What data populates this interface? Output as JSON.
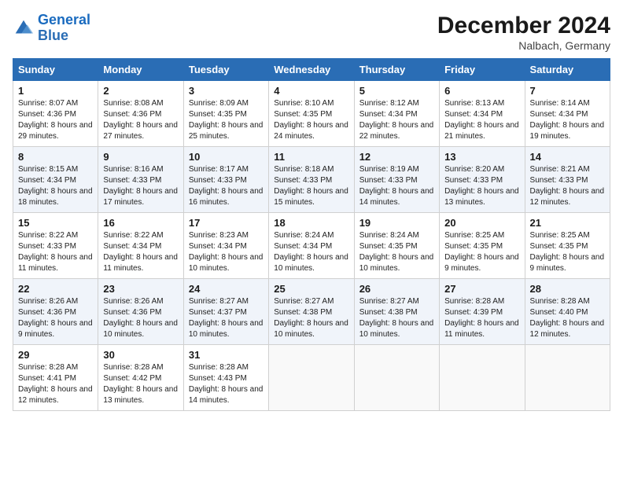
{
  "header": {
    "logo_line1": "General",
    "logo_line2": "Blue",
    "month": "December 2024",
    "location": "Nalbach, Germany"
  },
  "weekdays": [
    "Sunday",
    "Monday",
    "Tuesday",
    "Wednesday",
    "Thursday",
    "Friday",
    "Saturday"
  ],
  "weeks": [
    [
      {
        "day": 1,
        "sunrise": "8:07 AM",
        "sunset": "4:36 PM",
        "daylight": "8 hours and 29 minutes."
      },
      {
        "day": 2,
        "sunrise": "8:08 AM",
        "sunset": "4:36 PM",
        "daylight": "8 hours and 27 minutes."
      },
      {
        "day": 3,
        "sunrise": "8:09 AM",
        "sunset": "4:35 PM",
        "daylight": "8 hours and 25 minutes."
      },
      {
        "day": 4,
        "sunrise": "8:10 AM",
        "sunset": "4:35 PM",
        "daylight": "8 hours and 24 minutes."
      },
      {
        "day": 5,
        "sunrise": "8:12 AM",
        "sunset": "4:34 PM",
        "daylight": "8 hours and 22 minutes."
      },
      {
        "day": 6,
        "sunrise": "8:13 AM",
        "sunset": "4:34 PM",
        "daylight": "8 hours and 21 minutes."
      },
      {
        "day": 7,
        "sunrise": "8:14 AM",
        "sunset": "4:34 PM",
        "daylight": "8 hours and 19 minutes."
      }
    ],
    [
      {
        "day": 8,
        "sunrise": "8:15 AM",
        "sunset": "4:34 PM",
        "daylight": "8 hours and 18 minutes."
      },
      {
        "day": 9,
        "sunrise": "8:16 AM",
        "sunset": "4:33 PM",
        "daylight": "8 hours and 17 minutes."
      },
      {
        "day": 10,
        "sunrise": "8:17 AM",
        "sunset": "4:33 PM",
        "daylight": "8 hours and 16 minutes."
      },
      {
        "day": 11,
        "sunrise": "8:18 AM",
        "sunset": "4:33 PM",
        "daylight": "8 hours and 15 minutes."
      },
      {
        "day": 12,
        "sunrise": "8:19 AM",
        "sunset": "4:33 PM",
        "daylight": "8 hours and 14 minutes."
      },
      {
        "day": 13,
        "sunrise": "8:20 AM",
        "sunset": "4:33 PM",
        "daylight": "8 hours and 13 minutes."
      },
      {
        "day": 14,
        "sunrise": "8:21 AM",
        "sunset": "4:33 PM",
        "daylight": "8 hours and 12 minutes."
      }
    ],
    [
      {
        "day": 15,
        "sunrise": "8:22 AM",
        "sunset": "4:33 PM",
        "daylight": "8 hours and 11 minutes."
      },
      {
        "day": 16,
        "sunrise": "8:22 AM",
        "sunset": "4:34 PM",
        "daylight": "8 hours and 11 minutes."
      },
      {
        "day": 17,
        "sunrise": "8:23 AM",
        "sunset": "4:34 PM",
        "daylight": "8 hours and 10 minutes."
      },
      {
        "day": 18,
        "sunrise": "8:24 AM",
        "sunset": "4:34 PM",
        "daylight": "8 hours and 10 minutes."
      },
      {
        "day": 19,
        "sunrise": "8:24 AM",
        "sunset": "4:35 PM",
        "daylight": "8 hours and 10 minutes."
      },
      {
        "day": 20,
        "sunrise": "8:25 AM",
        "sunset": "4:35 PM",
        "daylight": "8 hours and 9 minutes."
      },
      {
        "day": 21,
        "sunrise": "8:25 AM",
        "sunset": "4:35 PM",
        "daylight": "8 hours and 9 minutes."
      }
    ],
    [
      {
        "day": 22,
        "sunrise": "8:26 AM",
        "sunset": "4:36 PM",
        "daylight": "8 hours and 9 minutes."
      },
      {
        "day": 23,
        "sunrise": "8:26 AM",
        "sunset": "4:36 PM",
        "daylight": "8 hours and 10 minutes."
      },
      {
        "day": 24,
        "sunrise": "8:27 AM",
        "sunset": "4:37 PM",
        "daylight": "8 hours and 10 minutes."
      },
      {
        "day": 25,
        "sunrise": "8:27 AM",
        "sunset": "4:38 PM",
        "daylight": "8 hours and 10 minutes."
      },
      {
        "day": 26,
        "sunrise": "8:27 AM",
        "sunset": "4:38 PM",
        "daylight": "8 hours and 10 minutes."
      },
      {
        "day": 27,
        "sunrise": "8:28 AM",
        "sunset": "4:39 PM",
        "daylight": "8 hours and 11 minutes."
      },
      {
        "day": 28,
        "sunrise": "8:28 AM",
        "sunset": "4:40 PM",
        "daylight": "8 hours and 12 minutes."
      }
    ],
    [
      {
        "day": 29,
        "sunrise": "8:28 AM",
        "sunset": "4:41 PM",
        "daylight": "8 hours and 12 minutes."
      },
      {
        "day": 30,
        "sunrise": "8:28 AM",
        "sunset": "4:42 PM",
        "daylight": "8 hours and 13 minutes."
      },
      {
        "day": 31,
        "sunrise": "8:28 AM",
        "sunset": "4:43 PM",
        "daylight": "8 hours and 14 minutes."
      },
      null,
      null,
      null,
      null
    ]
  ]
}
